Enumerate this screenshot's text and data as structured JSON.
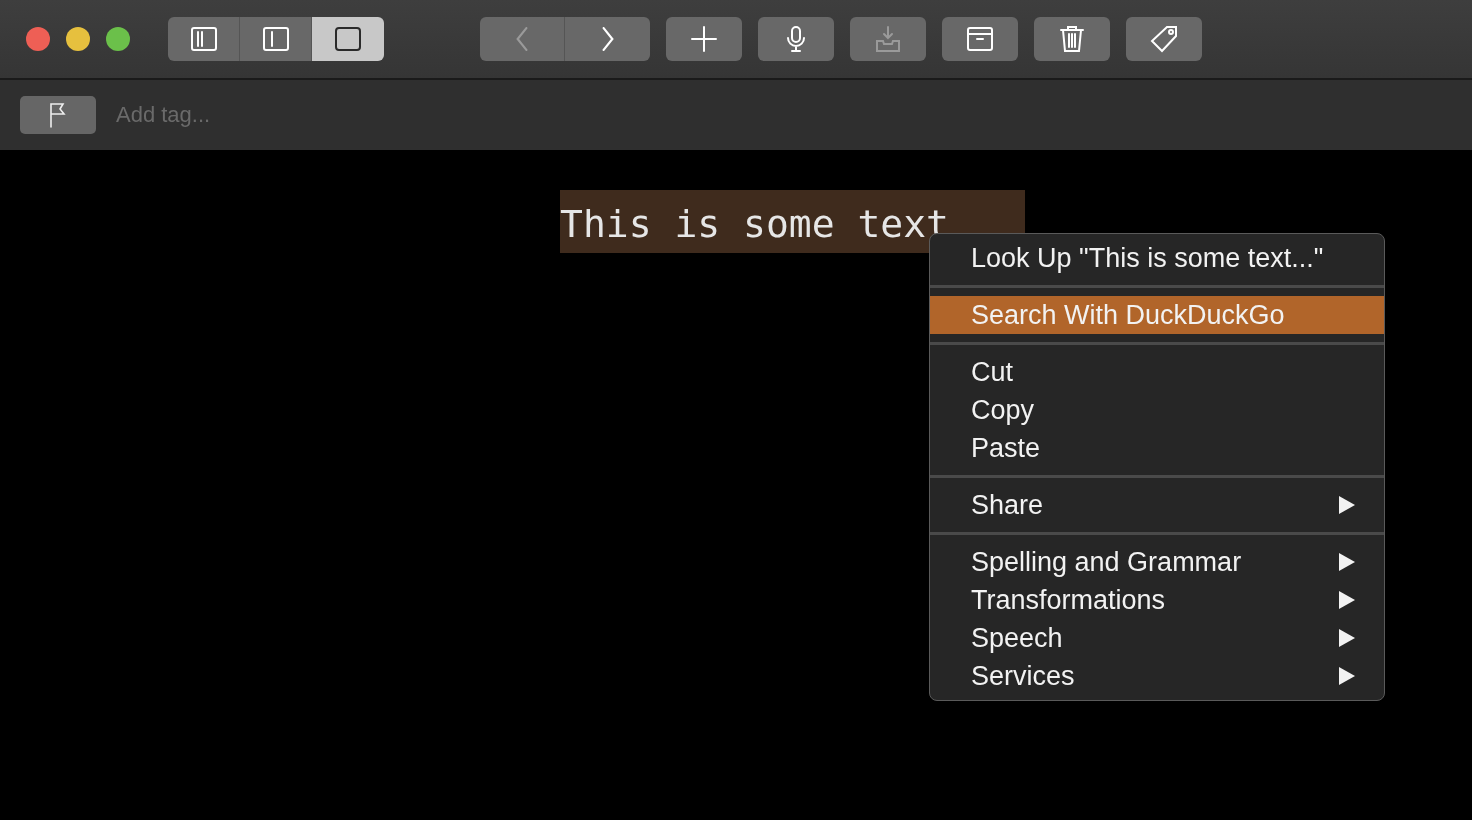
{
  "view_modes": [
    {
      "selected": false
    },
    {
      "selected": false
    },
    {
      "selected": true
    }
  ],
  "navigation": [
    {
      "disabled": true
    },
    {
      "disabled": false
    }
  ],
  "actions": [
    {
      "disabled": false
    },
    {
      "disabled": false
    },
    {
      "disabled": true
    },
    {
      "disabled": false
    },
    {
      "disabled": false
    },
    {
      "disabled": false
    }
  ],
  "tag_bar": {
    "placeholder": "Add tag..."
  },
  "editor": {
    "text": "This is some text",
    "selected": true
  },
  "context_menu": {
    "sections": [
      [
        {
          "label": "Look Up \"This is some text...\"",
          "selected": false,
          "submenu": false
        }
      ],
      [
        {
          "label": "Search With DuckDuckGo",
          "selected": true,
          "submenu": false
        }
      ],
      [
        {
          "label": "Cut",
          "selected": false,
          "submenu": false
        },
        {
          "label": "Copy",
          "selected": false,
          "submenu": false
        },
        {
          "label": "Paste",
          "selected": false,
          "submenu": false
        }
      ],
      [
        {
          "label": "Share",
          "selected": false,
          "submenu": true
        }
      ],
      [
        {
          "label": "Spelling and Grammar",
          "selected": false,
          "submenu": true
        },
        {
          "label": "Transformations",
          "selected": false,
          "submenu": true
        },
        {
          "label": "Speech",
          "selected": false,
          "submenu": true
        },
        {
          "label": "Services",
          "selected": false,
          "submenu": true
        }
      ]
    ]
  }
}
